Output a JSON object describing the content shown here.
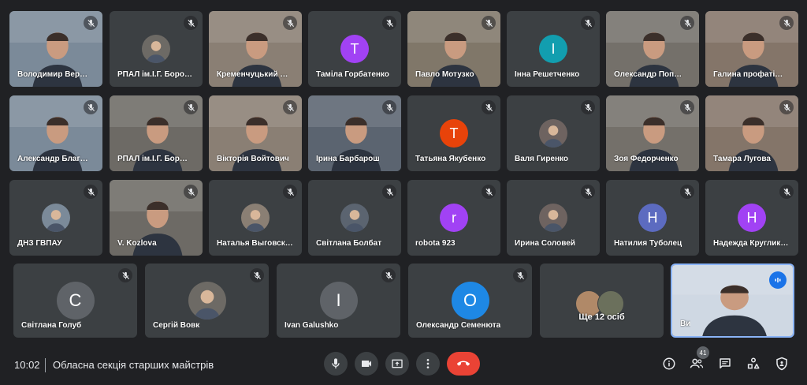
{
  "colors": {
    "background": "#202124",
    "tile": "#3c4043",
    "accent": "#8ab4f8",
    "end_call": "#ea4335"
  },
  "participants": [
    {
      "name": "Володимир Вер…",
      "type": "video"
    },
    {
      "name": "РПАЛ ім.І.Г. Боро…",
      "type": "photo-avatar"
    },
    {
      "name": "Кременчуцький …",
      "type": "video"
    },
    {
      "name": "Таміла Горбатенко",
      "type": "letter",
      "letter": "Т",
      "color": "#a142f4"
    },
    {
      "name": "Павло Мотузко",
      "type": "video"
    },
    {
      "name": "Інна Решетченко",
      "type": "letter",
      "letter": "І",
      "color": "#129eaf"
    },
    {
      "name": "Олександр Поп…",
      "type": "video"
    },
    {
      "name": "Галина профаті…",
      "type": "video"
    },
    {
      "name": "Александр Благ…",
      "type": "video"
    },
    {
      "name": "РПАЛ ім.І.Г. Бор…",
      "type": "video"
    },
    {
      "name": "Вікторія Войтович",
      "type": "video"
    },
    {
      "name": "Ірина Барбарош",
      "type": "video"
    },
    {
      "name": "Татьяна Якубенко",
      "type": "letter",
      "letter": "Т",
      "color": "#e8430a"
    },
    {
      "name": "Валя Гиренко",
      "type": "photo-avatar"
    },
    {
      "name": "Зоя Федорченко",
      "type": "video"
    },
    {
      "name": "Тамара Лугова",
      "type": "video"
    },
    {
      "name": "ДНЗ ГВПАУ",
      "type": "photo-avatar"
    },
    {
      "name": "V. Kozlova",
      "type": "video"
    },
    {
      "name": "Наталья Выговск…",
      "type": "photo-avatar"
    },
    {
      "name": "Світлана Болбат",
      "type": "photo-avatar"
    },
    {
      "name": "robota 923",
      "type": "letter",
      "letter": "r",
      "color": "#a142f4"
    },
    {
      "name": "Ирина Соловей",
      "type": "photo-avatar"
    },
    {
      "name": "Натилия Туболец",
      "type": "letter",
      "letter": "Н",
      "color": "#5c6bc0"
    },
    {
      "name": "Надежда Круглик…",
      "type": "letter",
      "letter": "Н",
      "color": "#a142f4"
    },
    {
      "name": "Світлана Голуб",
      "type": "letter",
      "letter": "С",
      "color": "#5f6368"
    },
    {
      "name": "Сергій Вовк",
      "type": "photo-avatar"
    },
    {
      "name": "Ivan Galushko",
      "type": "letter",
      "letter": "I",
      "color": "#5f6368"
    },
    {
      "name": "Олександр Семенюта",
      "type": "letter",
      "letter": "O",
      "color": "#1e88e5"
    },
    {
      "name": "Ще 12 осіб",
      "type": "more"
    },
    {
      "name": "Ви",
      "type": "self-video"
    }
  ],
  "meeting": {
    "time": "10:02",
    "title": "Обласна секція старших майстрів"
  },
  "participant_count": "41",
  "icons": {
    "controls": [
      "mic-icon",
      "camera-icon",
      "present-screen-icon",
      "more-options-icon",
      "end-call-icon"
    ],
    "right": [
      "info-icon",
      "people-icon",
      "chat-icon",
      "activities-icon",
      "host-controls-icon"
    ]
  }
}
